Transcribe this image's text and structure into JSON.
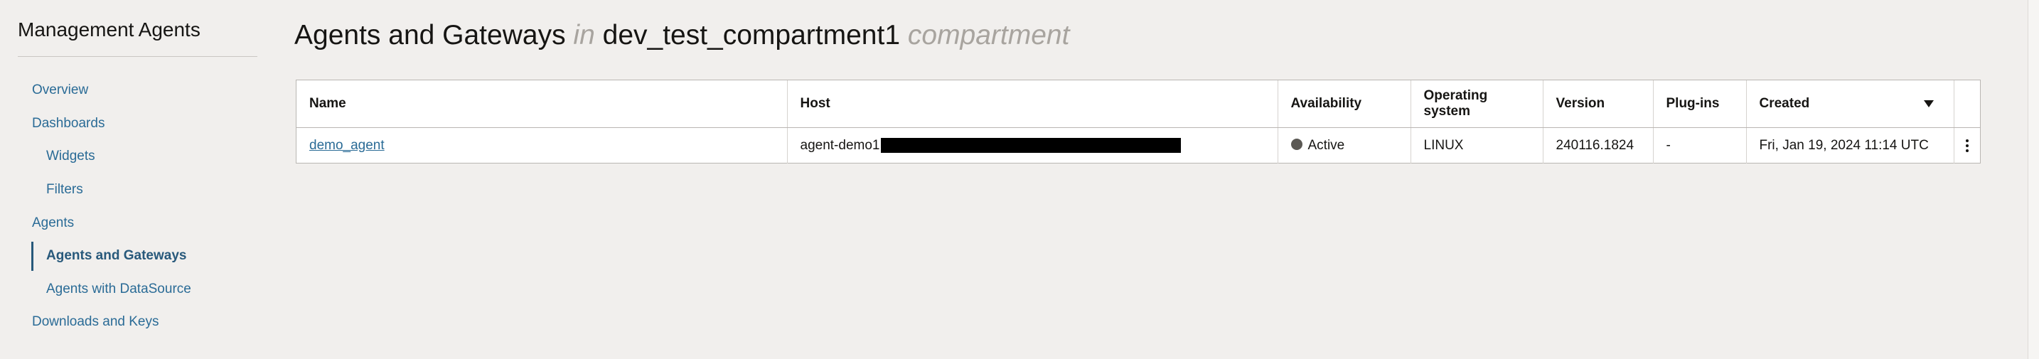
{
  "sidebar": {
    "title": "Management Agents",
    "items": [
      {
        "label": "Overview",
        "level": 1,
        "active": false
      },
      {
        "label": "Dashboards",
        "level": 1,
        "active": false
      },
      {
        "label": "Widgets",
        "level": 2,
        "active": false
      },
      {
        "label": "Filters",
        "level": 2,
        "active": false
      },
      {
        "label": "Agents",
        "level": 1,
        "active": false
      },
      {
        "label": "Agents and Gateways",
        "level": 2,
        "active": true
      },
      {
        "label": "Agents with DataSource",
        "level": 2,
        "active": false
      },
      {
        "label": "Downloads and Keys",
        "level": 1,
        "active": false
      }
    ]
  },
  "header": {
    "title": "Agents and Gateways",
    "in_word": "in",
    "compartment": "dev_test_compartment1",
    "compartment_word": "compartment"
  },
  "table": {
    "columns": {
      "name": "Name",
      "host": "Host",
      "availability": "Availability",
      "os": "Operating system",
      "version": "Version",
      "plugins": "Plug-ins",
      "created": "Created"
    },
    "sort_icon": "caret-down-icon",
    "rows": [
      {
        "name": "demo_agent",
        "host": "agent-demo1",
        "availability": "Active",
        "os": "LINUX",
        "version": "240116.1824",
        "plugins": "-",
        "created": "Fri, Jan 19, 2024 11:14 UTC"
      }
    ]
  },
  "colors": {
    "link": "#2a6b96",
    "active_nav": "#28597b",
    "background": "#f1efed",
    "status_active": "#5b5954"
  }
}
